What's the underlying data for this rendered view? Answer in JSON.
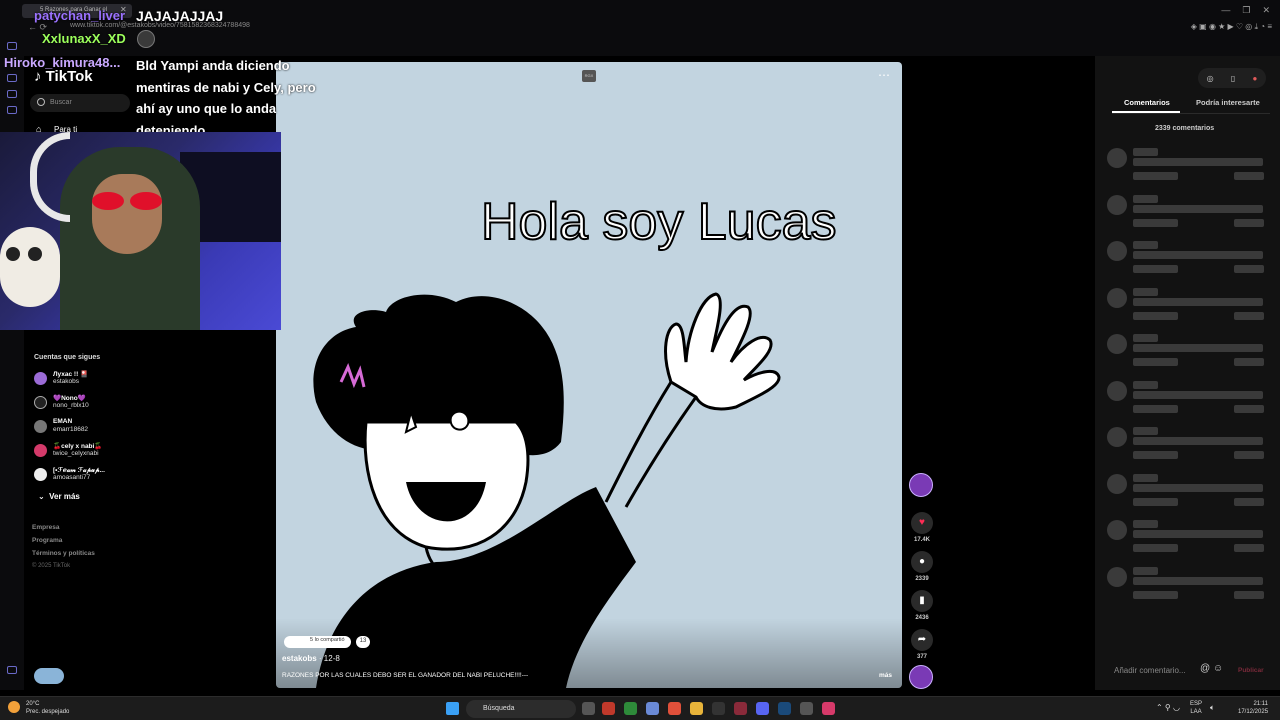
{
  "browser": {
    "tab_title": "5 Razones para Ganar el",
    "url": "www.tiktok.com/@estakobs/video/7581582368324788498",
    "nav": "←  ⟳",
    "win_controls": [
      "—",
      "❐",
      "✕"
    ],
    "ext_icons": "◈ ▣ ◉ ★ ▶ ♡ ◎ ⤓ ◔ ≡"
  },
  "chat": {
    "name1": "patychan_liver",
    "msg1": "JAJAJAJJAJ",
    "name2": "XxlunaxX_XD",
    "name3": "Hiroko_kimura48...",
    "msg3": "Bld Yampi anda diciendo mentiras de nabi y Cely, pero ahí ay uno que lo anda deteniendo"
  },
  "tiktok": {
    "logo": "♪ TikTok",
    "search_placeholder": "Buscar",
    "for_you": "Para ti",
    "following_title": "Cuentas que sigues",
    "accounts": [
      {
        "name": "Лухас !! 🎴",
        "user": "estakobs",
        "color": "#9b6bd6"
      },
      {
        "name": "💜Nono💜",
        "user": "nono_rblx10",
        "color": "#222"
      },
      {
        "name": "EMAN",
        "user": "emarr18682",
        "color": "#777"
      },
      {
        "name": "🍒cely x nabi🍒",
        "user": "twice_celyxnabi",
        "color": "#d43a6a"
      },
      {
        "name": "[•ℱℯ𝒶𝓂 ℱ𝒶𝓅𝓊𝓅...",
        "user": "amoasanti77",
        "color": "#eee"
      }
    ],
    "see_more": "Ver más",
    "footer": [
      "Empresa",
      "Programa",
      "Términos y políticas"
    ],
    "copyright": "© 2025 TikTok"
  },
  "video": {
    "caption": "Hola soy Lucas",
    "badge": "RGX",
    "shared_text": "5 lo compartió",
    "shared_count": "13",
    "author": "estakobs",
    "date": "· 12-8",
    "description": "RAZONES POR LAS CUALES DEBO SER EL GANADOR DEL NABI PELUCHE!!!!---",
    "more": "más"
  },
  "actions": {
    "likes": "17.4K",
    "comments": "2339",
    "saves": "2436",
    "shares": "377"
  },
  "comments_panel": {
    "tab_comments": "Comentarios",
    "tab_interest": "Podría interesarte",
    "count": "2339 comentarios",
    "input_placeholder": "Añadir comentario...",
    "publish": "Publicar"
  },
  "taskbar": {
    "temp": "20°C",
    "weather": "Prec. despejado",
    "search": "Búsqueda",
    "lang1": "ESP",
    "lang2": "LAA",
    "time": "21:11",
    "date": "17/12/2025"
  }
}
